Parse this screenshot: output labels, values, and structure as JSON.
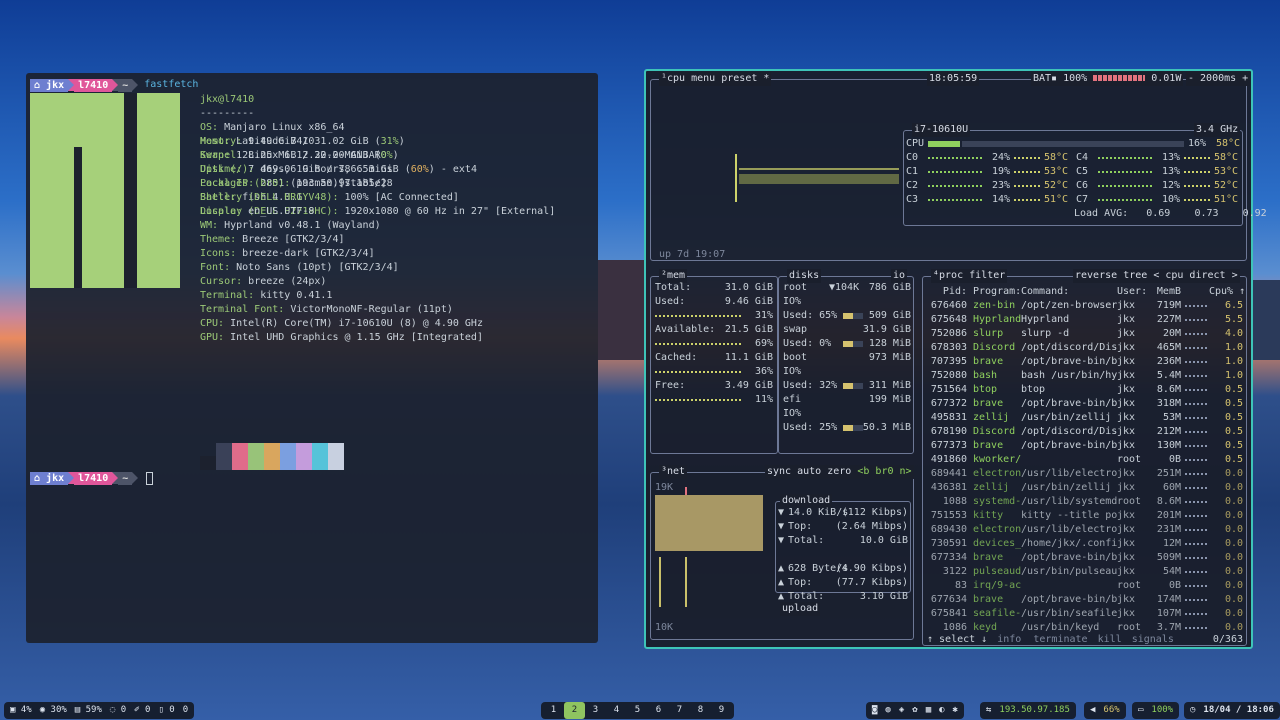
{
  "terminal": {
    "user": "jkx",
    "host": "l7410",
    "dir": "~",
    "command": "fastfetch",
    "title": "jkx@l7410",
    "separator": "---------",
    "info": [
      {
        "k": "OS:",
        "v": " Manjaro Linux x86_64"
      },
      {
        "k": "Host:",
        "v": " Latitude 7410"
      },
      {
        "k": "Kernel:",
        "v": " Linux 6.12.20-2-MANJARO"
      },
      {
        "k": "Uptime:",
        "v": " 7 days, 19 hours, 6 mins"
      },
      {
        "k": "Packages:",
        "v": " 2851 (pacman)[stable]"
      },
      {
        "k": "Shell:",
        "v": " fish 4.0.1"
      },
      {
        "k": "Display (DELL P2719HC):",
        "v": " 1920x1080 @ 60 Hz in 27\" [External]"
      },
      {
        "k": "WM:",
        "v": " Hyprland v0.48.1 (Wayland)"
      },
      {
        "k": "Theme:",
        "v": " Breeze [GTK2/3/4]"
      },
      {
        "k": "Icons:",
        "v": " breeze-dark [GTK2/3/4]"
      },
      {
        "k": "Font:",
        "v": " Noto Sans (10pt) [GTK2/3/4]"
      },
      {
        "k": "Cursor:",
        "v": " breeze (24px)"
      },
      {
        "k": "Terminal:",
        "v": " kitty 0.41.1"
      },
      {
        "k": "Terminal Font:",
        "v": " VictorMonoNF-Regular (11pt)"
      },
      {
        "k": "CPU:",
        "v": " Intel(R) Core(TM) i7-10610U (8) @ 4.90 GHz"
      },
      {
        "k": "GPU:",
        "v": " Intel UHD Graphics @ 1.15 GHz [Integrated]"
      }
    ],
    "memory": {
      "k": "Memory:",
      "v": " 9.49 GiB / 31.02 GiB (",
      "p": "31%",
      "e": ")"
    },
    "swap": {
      "k": "Swap:",
      "v": " 128.25 MiB / 32.00 GiB (",
      "p": "0%",
      "e": ")"
    },
    "disk": {
      "k": "Disk (/):",
      "v": " 469.06 GiB / 786.53 GiB (",
      "p": "60%",
      "e": ") - ext4"
    },
    "info2": [
      {
        "k": "Local IP (br0):",
        "v": " 193.50.97.185/28"
      },
      {
        "k": "Battery (DELL HRGYV48):",
        "v": " 100% [AC Connected]"
      },
      {
        "k": "Locale:",
        "v": " en_US.UTF-8"
      }
    ],
    "swatch_colors": [
      "#1c212e",
      "#3a4158",
      "#e06c8a",
      "#98c379",
      "#d9a65e",
      "#7b9fe0",
      "#c49cdc",
      "#56c3d9",
      "#c8d0e0"
    ]
  },
  "btop": {
    "cpu": {
      "tabs": [
        "¹cpu",
        "menu",
        "preset *"
      ],
      "clock": "18:05:59",
      "bat": "BAT▪ 100%",
      "power": "0.01W",
      "interval": "- 2000ms +",
      "model": "i7-10610U",
      "freq": "3.4 GHz",
      "total": {
        "name": "CPU",
        "pct": "16%",
        "temp": "58°C"
      },
      "cores": [
        {
          "name": "C0",
          "pct": "24%",
          "temp": "58°C"
        },
        {
          "name": "C1",
          "pct": "19%",
          "temp": "53°C"
        },
        {
          "name": "C2",
          "pct": "23%",
          "temp": "52°C"
        },
        {
          "name": "C3",
          "pct": "14%",
          "temp": "51°C"
        },
        {
          "name": "C4",
          "pct": "13%",
          "temp": "58°C"
        },
        {
          "name": "C5",
          "pct": "13%",
          "temp": "53°C"
        },
        {
          "name": "C6",
          "pct": "12%",
          "temp": "52°C"
        },
        {
          "name": "C7",
          "pct": "10%",
          "temp": "51°C"
        }
      ],
      "load_label": "Load AVG:",
      "load": [
        "0.69",
        "0.73",
        "0.92"
      ],
      "uptime": "up 7d 19:07"
    },
    "mem": {
      "title": "²mem",
      "rows": [
        {
          "l": "Total:",
          "v": "31.0 GiB"
        },
        {
          "l": "Used:",
          "v": "9.46 GiB",
          "p": "31%"
        },
        {
          "l": "Available:",
          "v": "21.5 GiB",
          "p": "69%"
        },
        {
          "l": "Cached:",
          "v": "11.1 GiB",
          "p": "36%"
        },
        {
          "l": "Free:",
          "v": "3.49 GiB",
          "p": "11%"
        }
      ]
    },
    "disks": {
      "title": "disks",
      "io_label": "io",
      "items": [
        {
          "name": "root",
          "speed": "▼104K",
          "size": "786 GiB",
          "io": "IO%",
          "used": "Used: 65%",
          "free": "509 GiB"
        },
        {
          "name": "swap",
          "size": "31.9 GiB",
          "used": "Used:  0%",
          "free": "128 MiB"
        },
        {
          "name": "boot",
          "size": "973 MiB",
          "io": "IO%",
          "used": "Used: 32%",
          "free": "311 MiB"
        },
        {
          "name": "efi",
          "size": "199 MiB",
          "io": "IO%",
          "used": "Used: 25%",
          "free": "50.3 MiB"
        }
      ]
    },
    "net": {
      "title": "³net",
      "controls": [
        "sync",
        "auto",
        "zero",
        "<b br0 n>"
      ],
      "scale_top": "19K",
      "scale_bottom": "10K",
      "download_label": "download",
      "upload_label": "upload",
      "down": [
        {
          "a": "▼",
          "l": "14.0 KiB/s",
          "v": "(112 Kibps)"
        },
        {
          "a": "▼",
          "l": "Top:",
          "v": "(2.64 Mibps)"
        },
        {
          "a": "▼",
          "l": "Total:",
          "v": "10.0 GiB"
        }
      ],
      "up": [
        {
          "a": "▲",
          "l": "628 Byte/s",
          "v": "(4.90 Kibps)"
        },
        {
          "a": "▲",
          "l": "Top:",
          "v": "(77.7 Kibps)"
        },
        {
          "a": "▲",
          "l": "Total:",
          "v": "3.10 GiB"
        }
      ]
    },
    "proc": {
      "title": "⁴proc",
      "filter": "filter",
      "controls": [
        "reverse",
        "tree",
        "< cpu direct >"
      ],
      "headers": [
        "Pid:",
        "Program:",
        "Command:",
        "User:",
        "MemB",
        "Cpu% ↑"
      ],
      "rows": [
        [
          "676460",
          "zen-bin",
          "/opt/zen-browser-",
          "jkx",
          "719M",
          "6.5"
        ],
        [
          "675648",
          "Hyprland",
          "Hyprland",
          "jkx",
          "227M",
          "5.5"
        ],
        [
          "752086",
          "slurp",
          "slurp -d",
          "jkx",
          "20M",
          "4.0"
        ],
        [
          "678303",
          "Discord",
          "/opt/discord/Disc",
          "jkx",
          "465M",
          "1.0"
        ],
        [
          "707395",
          "brave",
          "/opt/brave-bin/br",
          "jkx",
          "236M",
          "1.0"
        ],
        [
          "752080",
          "bash",
          "bash /usr/bin/hyp",
          "jkx",
          "5.4M",
          "1.0"
        ],
        [
          "751564",
          "btop",
          "btop",
          "jkx",
          "8.6M",
          "0.5"
        ],
        [
          "677372",
          "brave",
          "/opt/brave-bin/br",
          "jkx",
          "318M",
          "0.5"
        ],
        [
          "495831",
          "zellij",
          "/usr/bin/zellij -",
          "jkx",
          "53M",
          "0.5"
        ],
        [
          "678190",
          "Discord",
          "/opt/discord/Disc",
          "jkx",
          "212M",
          "0.5"
        ],
        [
          "677373",
          "brave",
          "/opt/brave-bin/br",
          "jkx",
          "130M",
          "0.5"
        ],
        [
          "491860",
          "kworker/",
          "",
          "root",
          "0B",
          "0.5"
        ],
        [
          "689441",
          "electron",
          "/usr/lib/electron",
          "jkx",
          "251M",
          "0.0"
        ],
        [
          "436381",
          "zellij",
          "/usr/bin/zellij -",
          "jkx",
          "60M",
          "0.0"
        ],
        [
          "1088",
          "systemd-",
          "/usr/lib/systemd/",
          "root",
          "8.6M",
          "0.0"
        ],
        [
          "751553",
          "kitty",
          "kitty --title pop",
          "jkx",
          "201M",
          "0.0"
        ],
        [
          "689430",
          "electron",
          "/usr/lib/electron",
          "jkx",
          "231M",
          "0.0"
        ],
        [
          "730591",
          "devices_",
          "/home/jkx/.config",
          "jkx",
          "12M",
          "0.0"
        ],
        [
          "677334",
          "brave",
          "/opt/brave-bin/br",
          "jkx",
          "509M",
          "0.0"
        ],
        [
          "3122",
          "pulseaud",
          "/usr/bin/pulseaud",
          "jkx",
          "54M",
          "0.0"
        ],
        [
          "83",
          "irq/9-ac",
          "",
          "root",
          "0B",
          "0.0"
        ],
        [
          "677634",
          "brave",
          "/opt/brave-bin/br",
          "jkx",
          "174M",
          "0.0"
        ],
        [
          "675841",
          "seafile-",
          "/usr/bin/seafile-",
          "jkx",
          "107M",
          "0.0"
        ],
        [
          "1086",
          "keyd",
          "/usr/bin/keyd",
          "root",
          "3.7M",
          "0.0"
        ]
      ],
      "footer": [
        "↑ select ↓",
        "info",
        "terminate",
        "kill",
        "signals",
        "0/363"
      ]
    }
  },
  "bar": {
    "left": [
      {
        "icon": "▣",
        "name": "cpu-icon",
        "v": "4%"
      },
      {
        "icon": "◉",
        "name": "memory-icon",
        "v": "30%"
      },
      {
        "icon": "▤",
        "name": "disk-icon",
        "v": "59%"
      },
      {
        "icon": "◌",
        "name": "notification-icon",
        "v": "0"
      },
      {
        "icon": "✐",
        "name": "updates-icon",
        "v": "0"
      },
      {
        "icon": "▯",
        "name": "device-icon",
        "v": "0"
      },
      {
        "icon": "",
        "name": "misc-icon",
        "v": "0"
      }
    ],
    "workspaces": [
      "1",
      "2",
      "3",
      "4",
      "5",
      "6",
      "7",
      "8",
      "9"
    ],
    "active_workspace": "2",
    "tray": [
      "◙",
      "◍",
      "◈",
      "✿",
      "▦",
      "◐",
      "✱"
    ],
    "network_ip": "193.50.97.185",
    "volume": "66%",
    "battery": "100%",
    "datetime": "18/04 / 18:06"
  }
}
